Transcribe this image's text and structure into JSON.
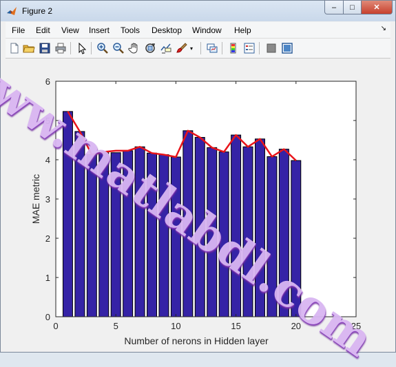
{
  "window": {
    "title": "Figure 2",
    "controls": {
      "minimize": "–",
      "maximize": "□",
      "close": "✕"
    }
  },
  "menu": {
    "items": [
      "File",
      "Edit",
      "View",
      "Insert",
      "Tools",
      "Desktop",
      "Window",
      "Help"
    ],
    "dock_arrow": "↘"
  },
  "toolbar": {
    "buttons": [
      "new-figure-icon",
      "open-file-icon",
      "save-icon",
      "print-icon",
      "select-arrow-icon",
      "zoom-in-icon",
      "zoom-out-icon",
      "pan-hand-icon",
      "rotate-3d-icon",
      "data-cursor-icon",
      "brush-icon",
      "link-plot-icon",
      "colorbar-icon",
      "legend-icon",
      "hide-tools-icon",
      "show-tools-icon"
    ]
  },
  "watermark": "www.matlabdl.com",
  "colors": {
    "bar_fill": "#3523a6",
    "bar_edge": "#000000",
    "line": "#e8141a",
    "axes_bg": "#ffffff",
    "window_bg": "#f0f0f0"
  },
  "chart_data": {
    "type": "bar",
    "x": [
      1,
      2,
      3,
      4,
      5,
      6,
      7,
      8,
      9,
      10,
      11,
      12,
      13,
      14,
      15,
      16,
      17,
      18,
      19,
      20
    ],
    "values": [
      5.23,
      4.72,
      4.13,
      4.18,
      4.18,
      4.23,
      4.33,
      4.17,
      4.13,
      4.07,
      4.74,
      4.57,
      4.31,
      4.2,
      4.63,
      4.33,
      4.53,
      4.08,
      4.27,
      3.98
    ],
    "line_values": [
      5.23,
      4.72,
      4.13,
      4.2,
      4.23,
      4.23,
      4.33,
      4.17,
      4.13,
      4.07,
      4.74,
      4.57,
      4.31,
      4.2,
      4.63,
      4.33,
      4.53,
      4.08,
      4.27,
      3.98
    ],
    "xlabel": "Number of nerons in Hidden layer",
    "ylabel": "MAE metric",
    "xlim": [
      0,
      25
    ],
    "ylim": [
      0,
      6
    ],
    "xticks": [
      0,
      5,
      10,
      15,
      20,
      25
    ],
    "yticks": [
      0,
      1,
      2,
      3,
      4,
      5,
      6
    ],
    "grid": false
  }
}
